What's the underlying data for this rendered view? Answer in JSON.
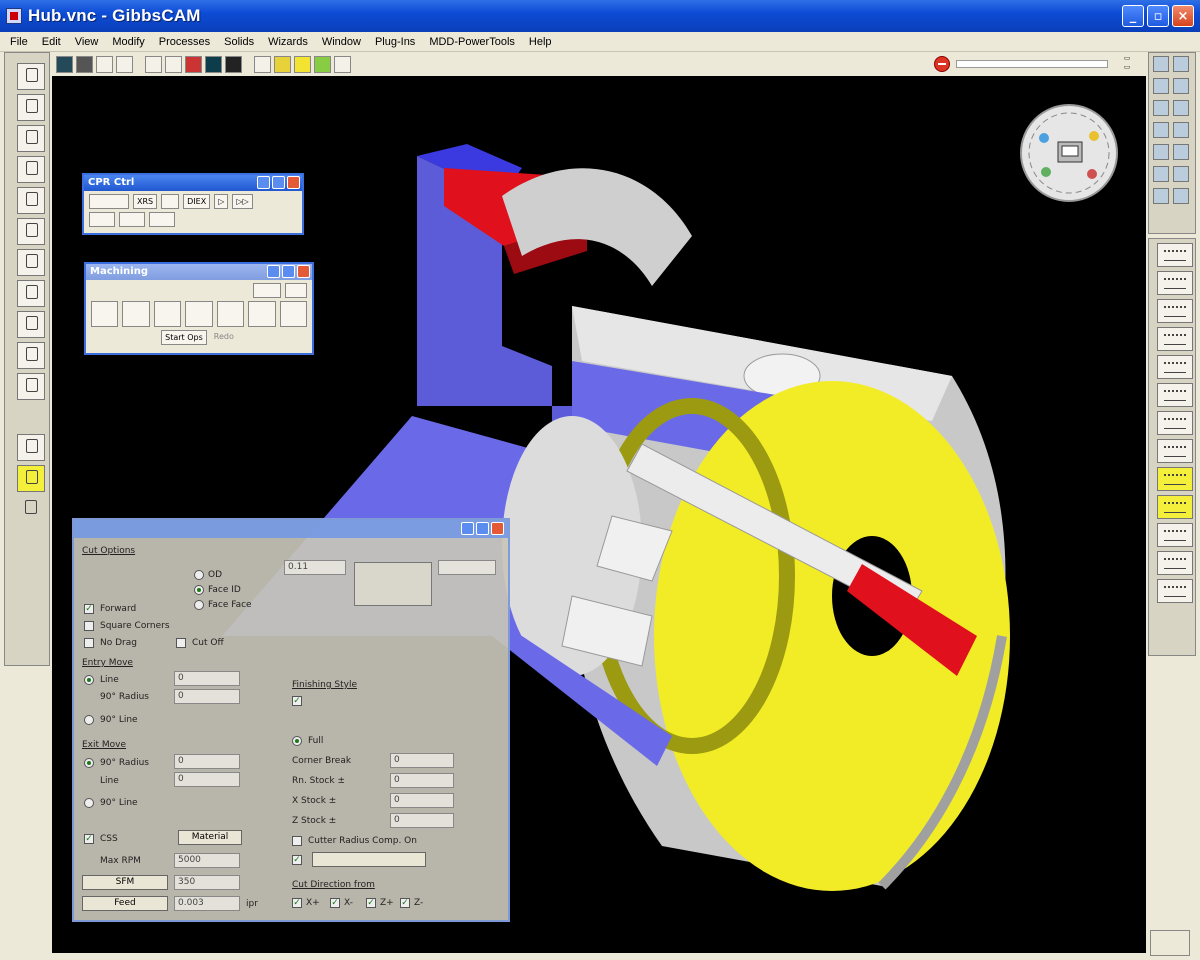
{
  "window": {
    "title": "Hub.vnc - GibbsCAM"
  },
  "menu": [
    "File",
    "Edit",
    "View",
    "Modify",
    "Processes",
    "Solids",
    "Wizards",
    "Window",
    "Plug-Ins",
    "MDD-PowerTools",
    "Help"
  ],
  "progress": {
    "value": 0.0
  },
  "dialogs": {
    "cpr": {
      "title": "CPR Ctrl",
      "chips": [
        "XRS",
        "DIEX"
      ]
    },
    "machining": {
      "title": "Machining",
      "start_ops_label": "Start Ops",
      "redo_label": "Redo"
    },
    "process": {
      "cut_options": "Cut Options",
      "forward": "Forward",
      "square_corners": "Square Corners",
      "no_drag": "No Drag",
      "cut_off": "Cut Off",
      "od": "OD",
      "face_id": "Face ID",
      "face_face": "Face Face",
      "entry_move": "Entry Move",
      "line": "Line",
      "radius_90": "90° Radius",
      "line_90": "90° Line",
      "exit_move": "Exit Move",
      "entry_val1": "0",
      "entry_val2": "0",
      "exit_val1": "0",
      "exit_val2": "0",
      "finishing_style": "Finishing Style",
      "full": "Full",
      "corner_break": "Corner Break",
      "rn_stock": "Rn. Stock ±",
      "x_stock": "X Stock ±",
      "z_stock": "Z Stock ±",
      "corner_val": "0",
      "rn_val": "0",
      "x_val": "0",
      "z_val": "0",
      "css": "CSS",
      "material_btn": "Material",
      "max_rpm": "Max RPM",
      "rpm_val": "5000",
      "sfm_btn": "SFM",
      "sfm_val": "350",
      "feed_btn": "Feed",
      "feed_val": "0.003",
      "feed_unit": "ipr",
      "cutter_comp": "Cutter Radius Comp. On",
      "cut_direction": "Cut Direction from",
      "dirs": [
        "X+",
        "X-",
        "Z+",
        "Z-"
      ],
      "top_field": "0.11"
    }
  },
  "colors": {
    "viewport_bg": "#000000",
    "part_blue": "#6a6ae8",
    "part_gray": "#cfcfcf",
    "interior_yellow": "#f2ec26",
    "accent_red": "#e0101c"
  }
}
